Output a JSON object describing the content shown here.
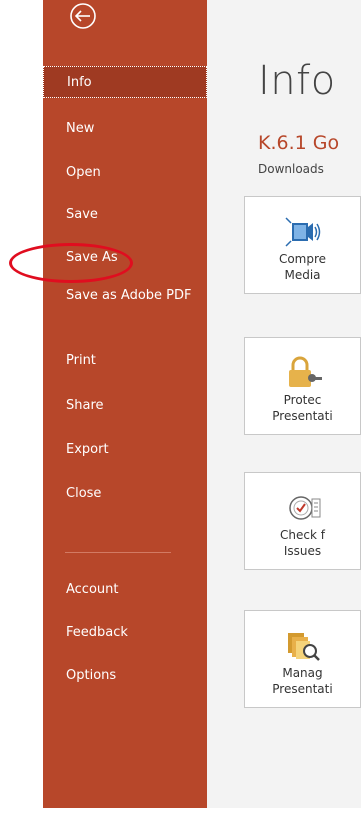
{
  "backstage": {
    "nav": [
      {
        "label": "Info"
      },
      {
        "label": "New"
      },
      {
        "label": "Open"
      },
      {
        "label": "Save"
      },
      {
        "label": "Save As"
      },
      {
        "label": "Save as Adobe PDF"
      },
      {
        "label": "Print"
      },
      {
        "label": "Share"
      },
      {
        "label": "Export"
      },
      {
        "label": "Close"
      },
      {
        "label": "Account"
      },
      {
        "label": "Feedback"
      },
      {
        "label": "Options"
      }
    ],
    "active_item": "Info",
    "highlighted_item": "Save As"
  },
  "main": {
    "title": "Info",
    "document_title": "K.6.1 Go",
    "location": "Downloads",
    "actions": [
      {
        "label": "Compre\nMedia",
        "icon": "compress-media-icon"
      },
      {
        "label": "Protec\nPresentati",
        "icon": "protect-presentation-icon"
      },
      {
        "label": "Check f\nIssues",
        "icon": "check-issues-icon"
      },
      {
        "label": "Manag\nPresentati",
        "icon": "manage-presentation-icon"
      }
    ]
  },
  "colors": {
    "accent": "#b7472a",
    "active_nav": "#9f3a22",
    "annotation": "#e00d1f"
  }
}
